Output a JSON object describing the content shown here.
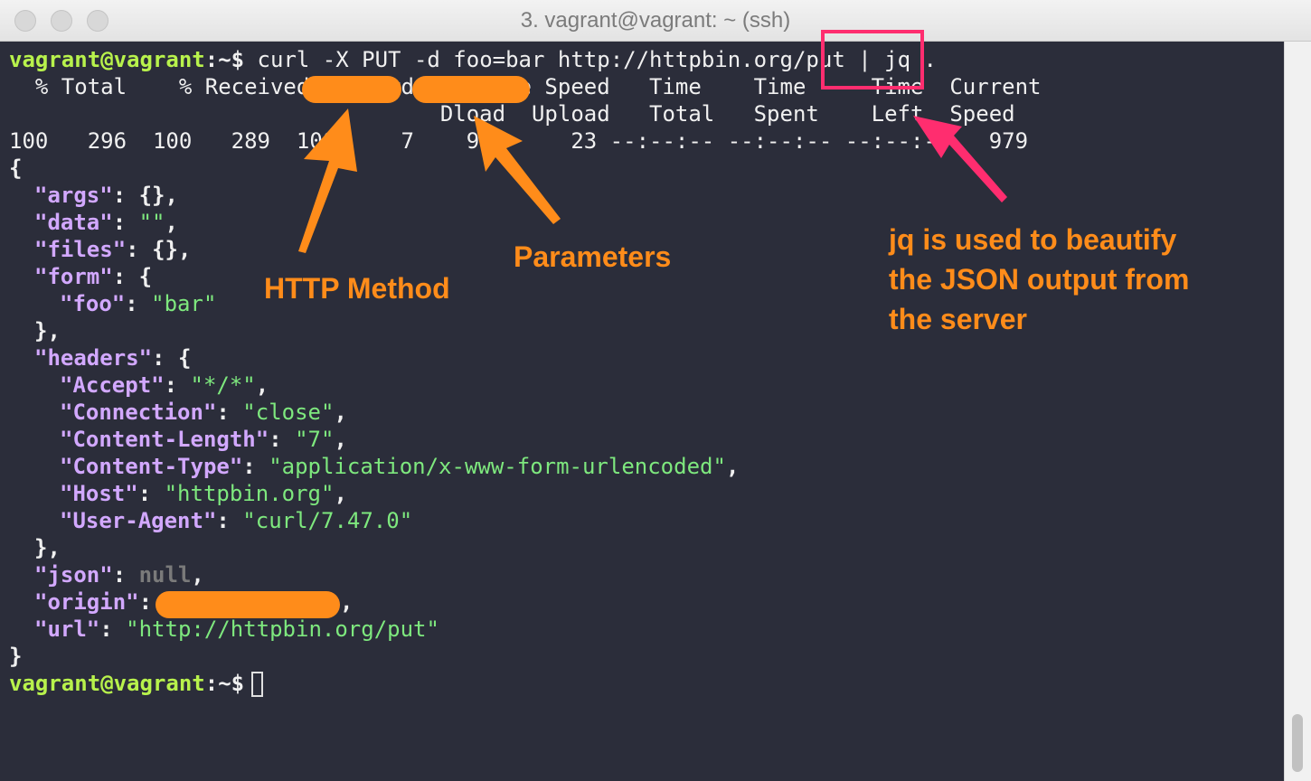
{
  "window": {
    "title": "3. vagrant@vagrant: ~ (ssh)"
  },
  "terminal": {
    "prompt_user": "vagrant@vagrant",
    "prompt_path": ":~$",
    "command": " curl -X PUT -d foo=bar http://httpbin.org/put | jq .",
    "progress_header1": "  % Total    % Received % Xferd  Average Speed   Time    Time     Time  Current",
    "progress_header2": "                                 Dload  Upload   Total   Spent    Left  Speed",
    "progress_values": "100   296  100   289  100     7    979     23 --:--:-- --:--:-- --:--:--   979",
    "json": {
      "open": "{",
      "args_key": "\"args\"",
      "args_val": "{},",
      "data_key": "\"data\"",
      "data_val": "\"\"",
      "files_key": "\"files\"",
      "files_val": "{},",
      "form_key": "\"form\"",
      "form_val": "{",
      "foo_key": "\"foo\"",
      "foo_val": "\"bar\"",
      "close_obj": "},",
      "headers_key": "\"headers\"",
      "headers_val": "{",
      "accept_key": "\"Accept\"",
      "accept_val": "\"*/*\"",
      "connection_key": "\"Connection\"",
      "connection_val": "\"close\"",
      "content_length_key": "\"Content-Length\"",
      "content_length_val": "\"7\"",
      "content_type_key": "\"Content-Type\"",
      "content_type_val": "\"application/x-www-form-urlencoded\"",
      "host_key": "\"Host\"",
      "host_val": "\"httpbin.org\"",
      "user_agent_key": "\"User-Agent\"",
      "user_agent_val": "\"curl/7.47.0\"",
      "json_key": "\"json\"",
      "json_val": "null",
      "origin_key": "\"origin\"",
      "url_key": "\"url\"",
      "url_val": "\"http://httpbin.org/put\"",
      "close": "}"
    }
  },
  "annotations": {
    "http_method": "HTTP Method",
    "parameters": "Parameters",
    "jq_note": "jq is used to beautify\nthe JSON output from\nthe server"
  },
  "colors": {
    "accent": "#ff8c1a",
    "highlight": "#ff2d6f",
    "terminal_bg": "#2b2d3a"
  }
}
